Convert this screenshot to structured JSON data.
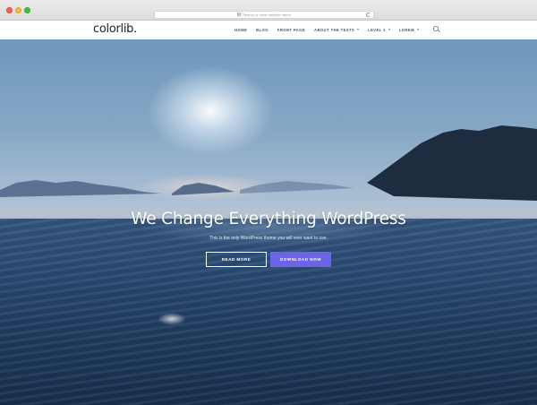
{
  "browser": {
    "url_placeholder": "Search or enter website name"
  },
  "header": {
    "logo": "colorlib.",
    "nav": [
      {
        "label": "HOME",
        "dropdown": false
      },
      {
        "label": "BLOG",
        "dropdown": false
      },
      {
        "label": "FRONT PAGE",
        "dropdown": false
      },
      {
        "label": "ABOUT THE TESTS",
        "dropdown": true
      },
      {
        "label": "LEVEL 1",
        "dropdown": true
      },
      {
        "label": "LOREM",
        "dropdown": true
      }
    ],
    "search_icon": "search-icon"
  },
  "hero": {
    "headline": "We Change Everything WordPress",
    "subline": "This is the only WordPress theme you will ever want to use.",
    "buttons": {
      "read_more": "READ MORE",
      "download_now": "DOWNLOAD NOW"
    }
  },
  "colors": {
    "accent": "#6c63e8",
    "chrome_red": "#fc5b57",
    "chrome_yellow": "#fdbc2e",
    "chrome_green": "#33c748"
  }
}
